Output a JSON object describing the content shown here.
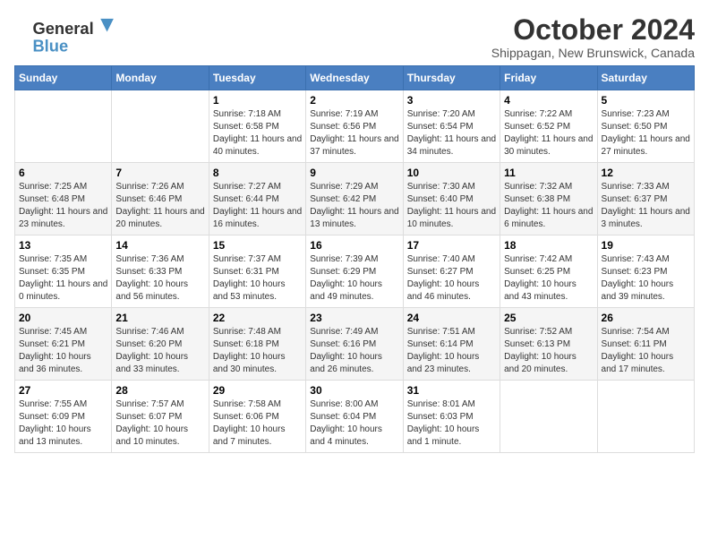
{
  "logo": {
    "line1": "General",
    "line2": "Blue"
  },
  "title": "October 2024",
  "subtitle": "Shippagan, New Brunswick, Canada",
  "days_of_week": [
    "Sunday",
    "Monday",
    "Tuesday",
    "Wednesday",
    "Thursday",
    "Friday",
    "Saturday"
  ],
  "weeks": [
    [
      {
        "day": "",
        "content": ""
      },
      {
        "day": "",
        "content": ""
      },
      {
        "day": "1",
        "sunrise": "Sunrise: 7:18 AM",
        "sunset": "Sunset: 6:58 PM",
        "daylight": "Daylight: 11 hours and 40 minutes."
      },
      {
        "day": "2",
        "sunrise": "Sunrise: 7:19 AM",
        "sunset": "Sunset: 6:56 PM",
        "daylight": "Daylight: 11 hours and 37 minutes."
      },
      {
        "day": "3",
        "sunrise": "Sunrise: 7:20 AM",
        "sunset": "Sunset: 6:54 PM",
        "daylight": "Daylight: 11 hours and 34 minutes."
      },
      {
        "day": "4",
        "sunrise": "Sunrise: 7:22 AM",
        "sunset": "Sunset: 6:52 PM",
        "daylight": "Daylight: 11 hours and 30 minutes."
      },
      {
        "day": "5",
        "sunrise": "Sunrise: 7:23 AM",
        "sunset": "Sunset: 6:50 PM",
        "daylight": "Daylight: 11 hours and 27 minutes."
      }
    ],
    [
      {
        "day": "6",
        "sunrise": "Sunrise: 7:25 AM",
        "sunset": "Sunset: 6:48 PM",
        "daylight": "Daylight: 11 hours and 23 minutes."
      },
      {
        "day": "7",
        "sunrise": "Sunrise: 7:26 AM",
        "sunset": "Sunset: 6:46 PM",
        "daylight": "Daylight: 11 hours and 20 minutes."
      },
      {
        "day": "8",
        "sunrise": "Sunrise: 7:27 AM",
        "sunset": "Sunset: 6:44 PM",
        "daylight": "Daylight: 11 hours and 16 minutes."
      },
      {
        "day": "9",
        "sunrise": "Sunrise: 7:29 AM",
        "sunset": "Sunset: 6:42 PM",
        "daylight": "Daylight: 11 hours and 13 minutes."
      },
      {
        "day": "10",
        "sunrise": "Sunrise: 7:30 AM",
        "sunset": "Sunset: 6:40 PM",
        "daylight": "Daylight: 11 hours and 10 minutes."
      },
      {
        "day": "11",
        "sunrise": "Sunrise: 7:32 AM",
        "sunset": "Sunset: 6:38 PM",
        "daylight": "Daylight: 11 hours and 6 minutes."
      },
      {
        "day": "12",
        "sunrise": "Sunrise: 7:33 AM",
        "sunset": "Sunset: 6:37 PM",
        "daylight": "Daylight: 11 hours and 3 minutes."
      }
    ],
    [
      {
        "day": "13",
        "sunrise": "Sunrise: 7:35 AM",
        "sunset": "Sunset: 6:35 PM",
        "daylight": "Daylight: 11 hours and 0 minutes."
      },
      {
        "day": "14",
        "sunrise": "Sunrise: 7:36 AM",
        "sunset": "Sunset: 6:33 PM",
        "daylight": "Daylight: 10 hours and 56 minutes."
      },
      {
        "day": "15",
        "sunrise": "Sunrise: 7:37 AM",
        "sunset": "Sunset: 6:31 PM",
        "daylight": "Daylight: 10 hours and 53 minutes."
      },
      {
        "day": "16",
        "sunrise": "Sunrise: 7:39 AM",
        "sunset": "Sunset: 6:29 PM",
        "daylight": "Daylight: 10 hours and 49 minutes."
      },
      {
        "day": "17",
        "sunrise": "Sunrise: 7:40 AM",
        "sunset": "Sunset: 6:27 PM",
        "daylight": "Daylight: 10 hours and 46 minutes."
      },
      {
        "day": "18",
        "sunrise": "Sunrise: 7:42 AM",
        "sunset": "Sunset: 6:25 PM",
        "daylight": "Daylight: 10 hours and 43 minutes."
      },
      {
        "day": "19",
        "sunrise": "Sunrise: 7:43 AM",
        "sunset": "Sunset: 6:23 PM",
        "daylight": "Daylight: 10 hours and 39 minutes."
      }
    ],
    [
      {
        "day": "20",
        "sunrise": "Sunrise: 7:45 AM",
        "sunset": "Sunset: 6:21 PM",
        "daylight": "Daylight: 10 hours and 36 minutes."
      },
      {
        "day": "21",
        "sunrise": "Sunrise: 7:46 AM",
        "sunset": "Sunset: 6:20 PM",
        "daylight": "Daylight: 10 hours and 33 minutes."
      },
      {
        "day": "22",
        "sunrise": "Sunrise: 7:48 AM",
        "sunset": "Sunset: 6:18 PM",
        "daylight": "Daylight: 10 hours and 30 minutes."
      },
      {
        "day": "23",
        "sunrise": "Sunrise: 7:49 AM",
        "sunset": "Sunset: 6:16 PM",
        "daylight": "Daylight: 10 hours and 26 minutes."
      },
      {
        "day": "24",
        "sunrise": "Sunrise: 7:51 AM",
        "sunset": "Sunset: 6:14 PM",
        "daylight": "Daylight: 10 hours and 23 minutes."
      },
      {
        "day": "25",
        "sunrise": "Sunrise: 7:52 AM",
        "sunset": "Sunset: 6:13 PM",
        "daylight": "Daylight: 10 hours and 20 minutes."
      },
      {
        "day": "26",
        "sunrise": "Sunrise: 7:54 AM",
        "sunset": "Sunset: 6:11 PM",
        "daylight": "Daylight: 10 hours and 17 minutes."
      }
    ],
    [
      {
        "day": "27",
        "sunrise": "Sunrise: 7:55 AM",
        "sunset": "Sunset: 6:09 PM",
        "daylight": "Daylight: 10 hours and 13 minutes."
      },
      {
        "day": "28",
        "sunrise": "Sunrise: 7:57 AM",
        "sunset": "Sunset: 6:07 PM",
        "daylight": "Daylight: 10 hours and 10 minutes."
      },
      {
        "day": "29",
        "sunrise": "Sunrise: 7:58 AM",
        "sunset": "Sunset: 6:06 PM",
        "daylight": "Daylight: 10 hours and 7 minutes."
      },
      {
        "day": "30",
        "sunrise": "Sunrise: 8:00 AM",
        "sunset": "Sunset: 6:04 PM",
        "daylight": "Daylight: 10 hours and 4 minutes."
      },
      {
        "day": "31",
        "sunrise": "Sunrise: 8:01 AM",
        "sunset": "Sunset: 6:03 PM",
        "daylight": "Daylight: 10 hours and 1 minute."
      },
      {
        "day": "",
        "content": ""
      },
      {
        "day": "",
        "content": ""
      }
    ]
  ]
}
